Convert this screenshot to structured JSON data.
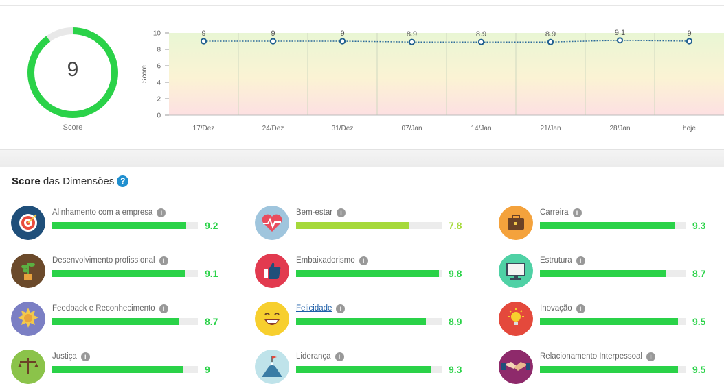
{
  "overall": {
    "score": "9",
    "score_label": "Score",
    "fraction": 0.9,
    "color": "#2ad248"
  },
  "chart_data": {
    "type": "line",
    "x": [
      "17/Dez",
      "24/Dez",
      "31/Dez",
      "07/Jan",
      "14/Jan",
      "21/Jan",
      "28/Jan",
      "hoje"
    ],
    "series": [
      {
        "values": [
          9,
          9,
          9,
          8.9,
          8.9,
          8.9,
          9.1,
          9
        ]
      }
    ],
    "point_labels": [
      "9",
      "9",
      "9",
      "8.9",
      "8.9",
      "8.9",
      "9.1",
      "9"
    ],
    "ylabel": "Score",
    "ylim": [
      0,
      10
    ],
    "yticks": [
      "0",
      "2",
      "4",
      "6",
      "8",
      "10"
    ],
    "grid": true,
    "background": "gradient green-yellow-red"
  },
  "section": {
    "title_bold": "Score",
    "title_rest": " das Dimensões",
    "help": "?"
  },
  "dimensions": [
    {
      "name": "Alinhamento com a empresa",
      "value": "9.2",
      "score": 9.2,
      "color": "#2ad248",
      "icon": "target-icon"
    },
    {
      "name": "Bem-estar",
      "value": "7.8",
      "score": 7.8,
      "color": "#a6d93a",
      "icon": "heartbeat-icon"
    },
    {
      "name": "Carreira",
      "value": "9.3",
      "score": 9.3,
      "color": "#2ad248",
      "icon": "briefcase-icon"
    },
    {
      "name": "Desenvolvimento profissional",
      "value": "9.1",
      "score": 9.1,
      "color": "#2ad248",
      "icon": "plant-icon"
    },
    {
      "name": "Embaixadorismo",
      "value": "9.8",
      "score": 9.8,
      "color": "#2ad248",
      "icon": "thumbs-up-icon"
    },
    {
      "name": "Estrutura",
      "value": "8.7",
      "score": 8.7,
      "color": "#2ad248",
      "icon": "monitor-icon"
    },
    {
      "name": "Feedback e Reconhecimento",
      "value": "8.7",
      "score": 8.7,
      "color": "#2ad248",
      "icon": "medal-icon"
    },
    {
      "name": "Felicidade",
      "value": "8.9",
      "score": 8.9,
      "color": "#2ad248",
      "icon": "smile-icon"
    },
    {
      "name": "Inovação",
      "value": "9.5",
      "score": 9.5,
      "color": "#2ad248",
      "icon": "lightbulb-icon"
    },
    {
      "name": "Justiça",
      "value": "9",
      "score": 9,
      "color": "#2ad248",
      "icon": "scale-icon"
    },
    {
      "name": "Liderança",
      "value": "9.3",
      "score": 9.3,
      "color": "#2ad248",
      "icon": "mountain-flag-icon"
    },
    {
      "name": "Relacionamento Interpessoal",
      "value": "9.5",
      "score": 9.5,
      "color": "#2ad248",
      "icon": "handshake-icon"
    }
  ]
}
